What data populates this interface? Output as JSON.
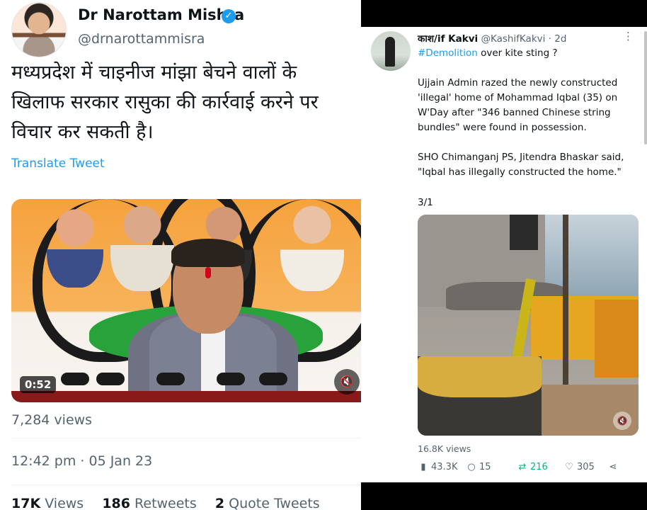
{
  "left_tweet": {
    "author_name": "Dr Narottam Mishra",
    "verified_badge": "✓",
    "handle": "@drnarottammisra",
    "text_lines": [
      "मध्यप्रदेश में चाइनीज मांझा बेचने वालों के",
      "खिलाफ सरकार रासुका की कार्रवाई करने पर",
      "विचार कर सकती है।"
    ],
    "translate_label": "Translate Tweet",
    "video": {
      "duration": "0:52",
      "mute_icon": "speaker-muted-icon"
    },
    "views": "7,284 views",
    "timestamp": "12:42 pm · 05 Jan 23",
    "stats": {
      "views_count": "17K",
      "views_label": "Views",
      "retweets_count": "186",
      "retweets_label": "Retweets",
      "quotes_count": "2",
      "quotes_label": "Quote Tweets"
    }
  },
  "right_tweet": {
    "author_name": "काश/if Kakvi",
    "handle_time": "@KashifKakvi · 2d",
    "more_icon": "⋮",
    "hashtag": "#Demolition",
    "line1_rest": " over kite sting ?",
    "paragraph1": [
      "Ujjain Admin razed the newly constructed",
      "'illegal' home of Mohammad Iqbal (35) on",
      "W'Day after \"346 banned Chinese string",
      "bundles\" were found in possession."
    ],
    "paragraph2": [
      "SHO Chimanganj PS, Jitendra Bhaskar said,",
      "\"Iqbal has illegally constructed the home.\""
    ],
    "thread_count": "3/1",
    "views": "16.8K views",
    "actions": {
      "analytics_icon": "bar-chart-icon",
      "analytics_count": "43.3K",
      "reply_icon": "reply-icon",
      "reply_count": "15",
      "retweet_icon": "retweet-icon",
      "retweet_count": "216",
      "like_icon": "heart-icon",
      "like_count": "305",
      "share_icon": "share-icon"
    }
  },
  "colors": {
    "accent": "#1d9bf0",
    "text": "#0f1419",
    "muted": "#536471",
    "retweet_green": "#00ba7c",
    "background_bars": "#000000"
  }
}
